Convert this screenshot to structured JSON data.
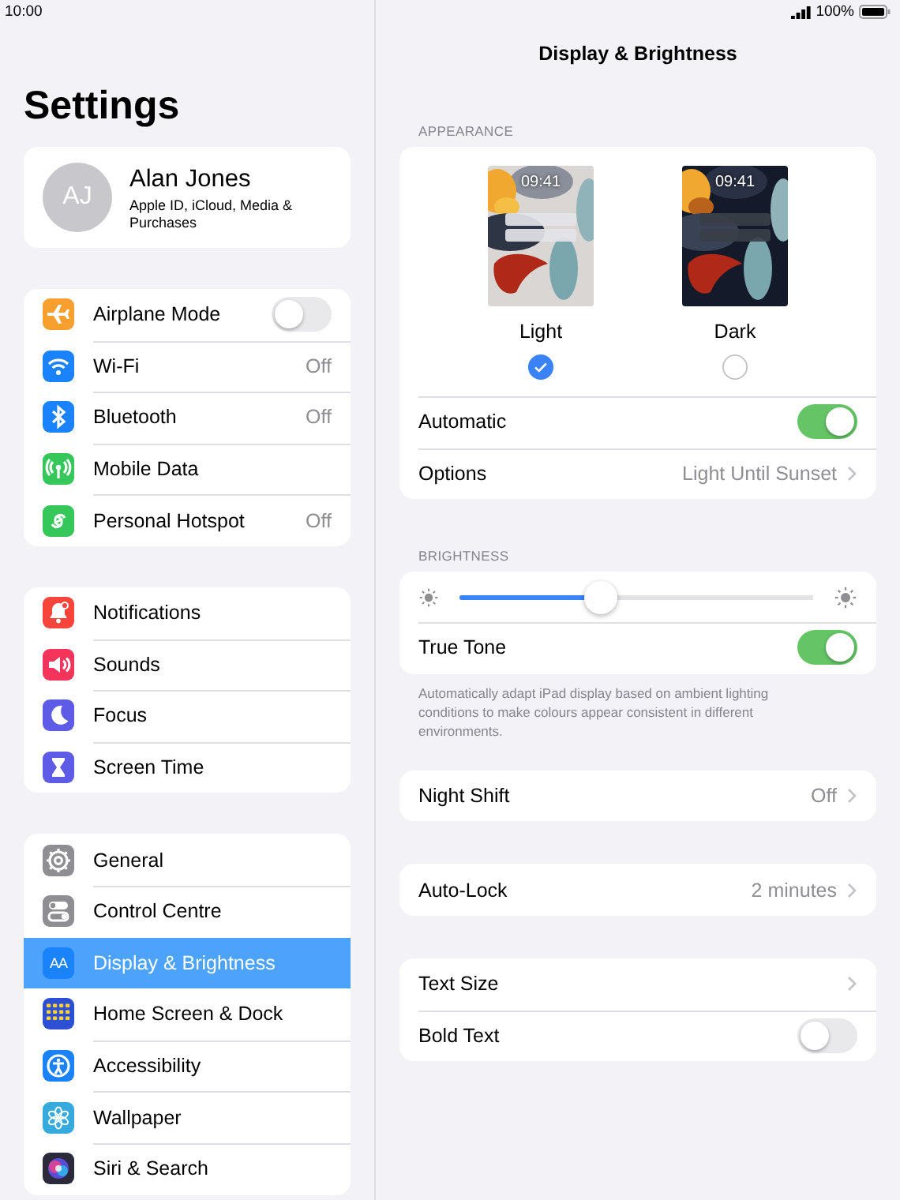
{
  "status_bar": {
    "time": "10:00",
    "battery": "100%"
  },
  "sidebar": {
    "title": "Settings",
    "profile": {
      "initials": "AJ",
      "name": "Alan Jones",
      "subtitle": "Apple ID, iCloud, Media & Purchases"
    },
    "groups": [
      [
        {
          "label": "Airplane Mode",
          "kind": "toggle",
          "on": false,
          "color": "#f7a030",
          "selected": false
        },
        {
          "label": "Wi-Fi",
          "kind": "value",
          "value": "Off",
          "color": "#1a82fb",
          "selected": false
        },
        {
          "label": "Bluetooth",
          "kind": "value",
          "value": "Off",
          "color": "#1a82fb",
          "selected": false
        },
        {
          "label": "Mobile Data",
          "kind": "plain",
          "color": "#35c759",
          "selected": false
        },
        {
          "label": "Personal Hotspot",
          "kind": "value",
          "value": "Off",
          "color": "#35c759",
          "selected": false
        }
      ],
      [
        {
          "label": "Notifications",
          "kind": "plain",
          "color": "#f7453b",
          "selected": false
        },
        {
          "label": "Sounds",
          "kind": "plain",
          "color": "#f5345c",
          "selected": false
        },
        {
          "label": "Focus",
          "kind": "plain",
          "color": "#5e5ce6",
          "selected": false
        },
        {
          "label": "Screen Time",
          "kind": "plain",
          "color": "#5e5ce6",
          "selected": false
        }
      ],
      [
        {
          "label": "General",
          "kind": "plain",
          "color": "#8e8e93",
          "selected": false
        },
        {
          "label": "Control Centre",
          "kind": "plain",
          "color": "#8e8e93",
          "selected": false
        },
        {
          "label": "Display & Brightness",
          "kind": "plain",
          "color": "#1a82fb",
          "selected": true,
          "icon_text": "AA"
        },
        {
          "label": "Home Screen & Dock",
          "kind": "plain",
          "color": "#2c4fd6",
          "selected": false
        },
        {
          "label": "Accessibility",
          "kind": "plain",
          "color": "#1a82fb",
          "selected": false
        },
        {
          "label": "Wallpaper",
          "kind": "plain",
          "color": "#36aadc",
          "selected": false
        },
        {
          "label": "Siri & Search",
          "kind": "plain",
          "color": "#2a2a3a",
          "selected": false
        }
      ]
    ]
  },
  "detail": {
    "title": "Display & Brightness",
    "appearance": {
      "header": "APPEARANCE",
      "options": [
        {
          "label": "Light",
          "preview_time": "09:41",
          "selected": true
        },
        {
          "label": "Dark",
          "preview_time": "09:41",
          "selected": false
        }
      ],
      "rows": [
        {
          "label": "Automatic",
          "kind": "toggle",
          "on": true
        },
        {
          "label": "Options",
          "kind": "value",
          "value": "Light Until Sunset"
        }
      ]
    },
    "brightness": {
      "header": "BRIGHTNESS",
      "level": 0.4,
      "rows": [
        {
          "label": "True Tone",
          "kind": "toggle",
          "on": true
        }
      ],
      "footnote": "Automatically adapt iPad display based on ambient lighting conditions to make colours appear consistent in different environments."
    },
    "groups": [
      [
        {
          "label": "Night Shift",
          "kind": "value",
          "value": "Off"
        }
      ],
      [
        {
          "label": "Auto-Lock",
          "kind": "value",
          "value": "2 minutes"
        }
      ],
      [
        {
          "label": "Text Size",
          "kind": "link"
        },
        {
          "label": "Bold Text",
          "kind": "toggle",
          "on": false
        }
      ]
    ]
  }
}
